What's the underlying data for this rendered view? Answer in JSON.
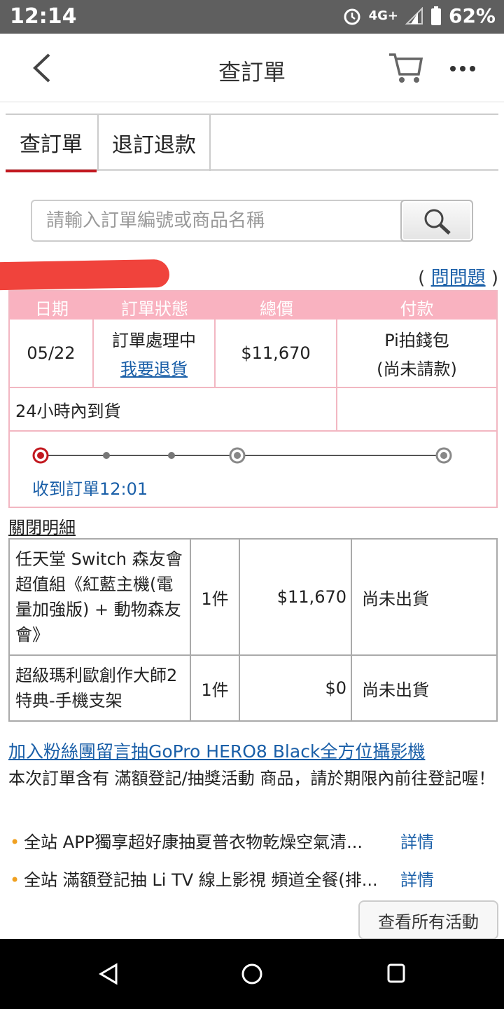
{
  "status_bar": {
    "time": "12:14",
    "network": "4G+",
    "battery": "62%"
  },
  "app_bar": {
    "title": "查訂單"
  },
  "tabs": [
    {
      "label": "查訂單"
    },
    {
      "label": "退訂退款"
    }
  ],
  "search": {
    "placeholder": "請輸入訂單編號或商品名稱"
  },
  "help": {
    "open": "(",
    "link": "問問題",
    "close": ")"
  },
  "order": {
    "headers": [
      "日期",
      "訂單狀態",
      "總價",
      "付款"
    ],
    "date": "05/22",
    "status": "訂單處理中",
    "refund_link": "我要退貨",
    "total": "$11,670",
    "payment_method": "Pi拍錢包",
    "payment_status": "(尚未請款)",
    "delivery": "24小時內到貨",
    "progress_label": "收到訂單12:01"
  },
  "close_detail": "關閉明細",
  "items": [
    {
      "name": "任天堂 Switch 森友會 超值組《紅藍主機(電量加強版) + 動物森友會》",
      "qty": "1件",
      "price": "$11,670",
      "status": "尚未出貨"
    },
    {
      "name": "超級瑪利歐創作大師2 特典-手機支架",
      "qty": "1件",
      "price": "$0",
      "status": "尚未出貨"
    }
  ],
  "promo": {
    "link": "加入粉絲團留言抽GoPro HERO8 Black全方位攝影機",
    "notice": "本次訂單含有 滿額登記/抽獎活動 商品，請於期限內前往登記喔！"
  },
  "events": [
    {
      "text": "全站 APP獨享超好康抽夏普衣物乾燥空氣清...",
      "detail": "詳情"
    },
    {
      "text": "全站 滿額登記抽 Li TV 線上影視 頻道全餐(排...",
      "detail": "詳情"
    }
  ],
  "all_events_button": "查看所有活動",
  "colors": {
    "accent_red": "#c2181f",
    "link_blue": "#1a5fa8",
    "table_pink": "#f9b2c0"
  }
}
